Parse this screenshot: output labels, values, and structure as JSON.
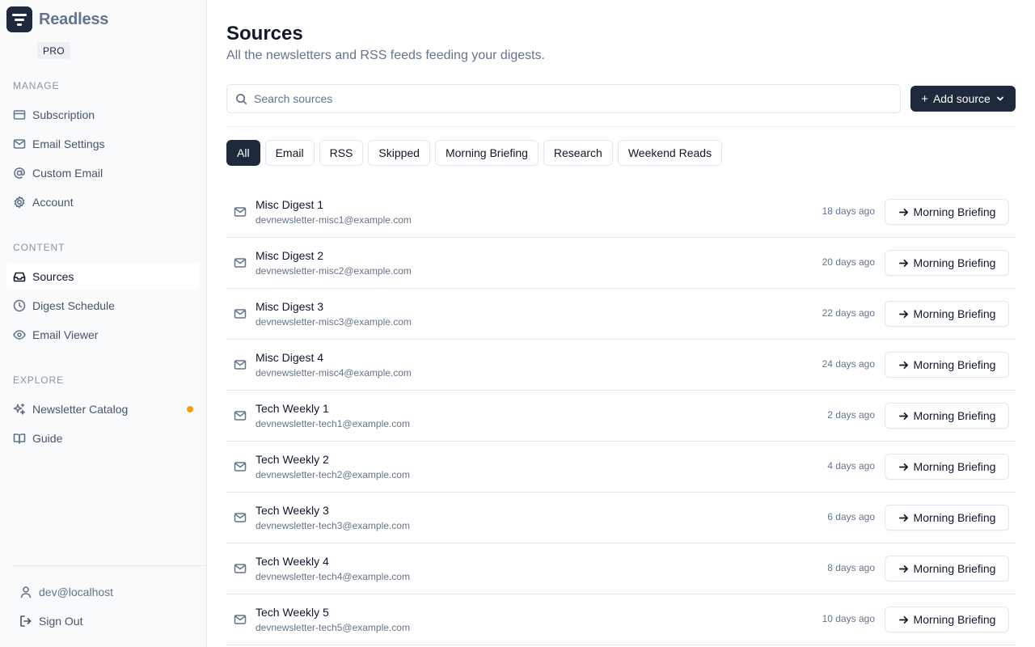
{
  "app": {
    "name": "Readless",
    "plan_badge": "PRO"
  },
  "sidebar": {
    "sections": [
      {
        "label": "MANAGE",
        "items": [
          {
            "label": "Subscription",
            "icon": "credit-card-icon"
          },
          {
            "label": "Email Settings",
            "icon": "mail-icon"
          },
          {
            "label": "Custom Email",
            "icon": "at-sign-icon"
          },
          {
            "label": "Account",
            "icon": "gear-icon"
          }
        ]
      },
      {
        "label": "CONTENT",
        "items": [
          {
            "label": "Sources",
            "icon": "inbox-icon",
            "active": true
          },
          {
            "label": "Digest Schedule",
            "icon": "clock-icon"
          },
          {
            "label": "Email Viewer",
            "icon": "eye-icon"
          }
        ]
      },
      {
        "label": "EXPLORE",
        "items": [
          {
            "label": "Newsletter Catalog",
            "icon": "sparkles-icon",
            "indicator_color": "#f59e0b"
          },
          {
            "label": "Guide",
            "icon": "book-icon"
          }
        ]
      }
    ],
    "footer": {
      "user": "dev@localhost",
      "sign_out": "Sign Out"
    }
  },
  "main": {
    "title": "Sources",
    "subtitle": "All the newsletters and RSS feeds feeding your digests.",
    "search": {
      "placeholder": "Search sources"
    },
    "add_button": "Add source",
    "filters": [
      {
        "label": "All",
        "active": true
      },
      {
        "label": "Email"
      },
      {
        "label": "RSS"
      },
      {
        "label": "Skipped"
      },
      {
        "label": "Morning Briefing"
      },
      {
        "label": "Research"
      },
      {
        "label": "Weekend Reads"
      }
    ],
    "sources": [
      {
        "name": "Misc Digest 1",
        "email": "devnewsletter-misc1@example.com",
        "time": "18 days ago",
        "destination": "Morning Briefing"
      },
      {
        "name": "Misc Digest 2",
        "email": "devnewsletter-misc2@example.com",
        "time": "20 days ago",
        "destination": "Morning Briefing"
      },
      {
        "name": "Misc Digest 3",
        "email": "devnewsletter-misc3@example.com",
        "time": "22 days ago",
        "destination": "Morning Briefing"
      },
      {
        "name": "Misc Digest 4",
        "email": "devnewsletter-misc4@example.com",
        "time": "24 days ago",
        "destination": "Morning Briefing"
      },
      {
        "name": "Tech Weekly 1",
        "email": "devnewsletter-tech1@example.com",
        "time": "2 days ago",
        "destination": "Morning Briefing"
      },
      {
        "name": "Tech Weekly 2",
        "email": "devnewsletter-tech2@example.com",
        "time": "4 days ago",
        "destination": "Morning Briefing"
      },
      {
        "name": "Tech Weekly 3",
        "email": "devnewsletter-tech3@example.com",
        "time": "6 days ago",
        "destination": "Morning Briefing"
      },
      {
        "name": "Tech Weekly 4",
        "email": "devnewsletter-tech4@example.com",
        "time": "8 days ago",
        "destination": "Morning Briefing"
      },
      {
        "name": "Tech Weekly 5",
        "email": "devnewsletter-tech5@example.com",
        "time": "10 days ago",
        "destination": "Morning Briefing"
      }
    ]
  }
}
